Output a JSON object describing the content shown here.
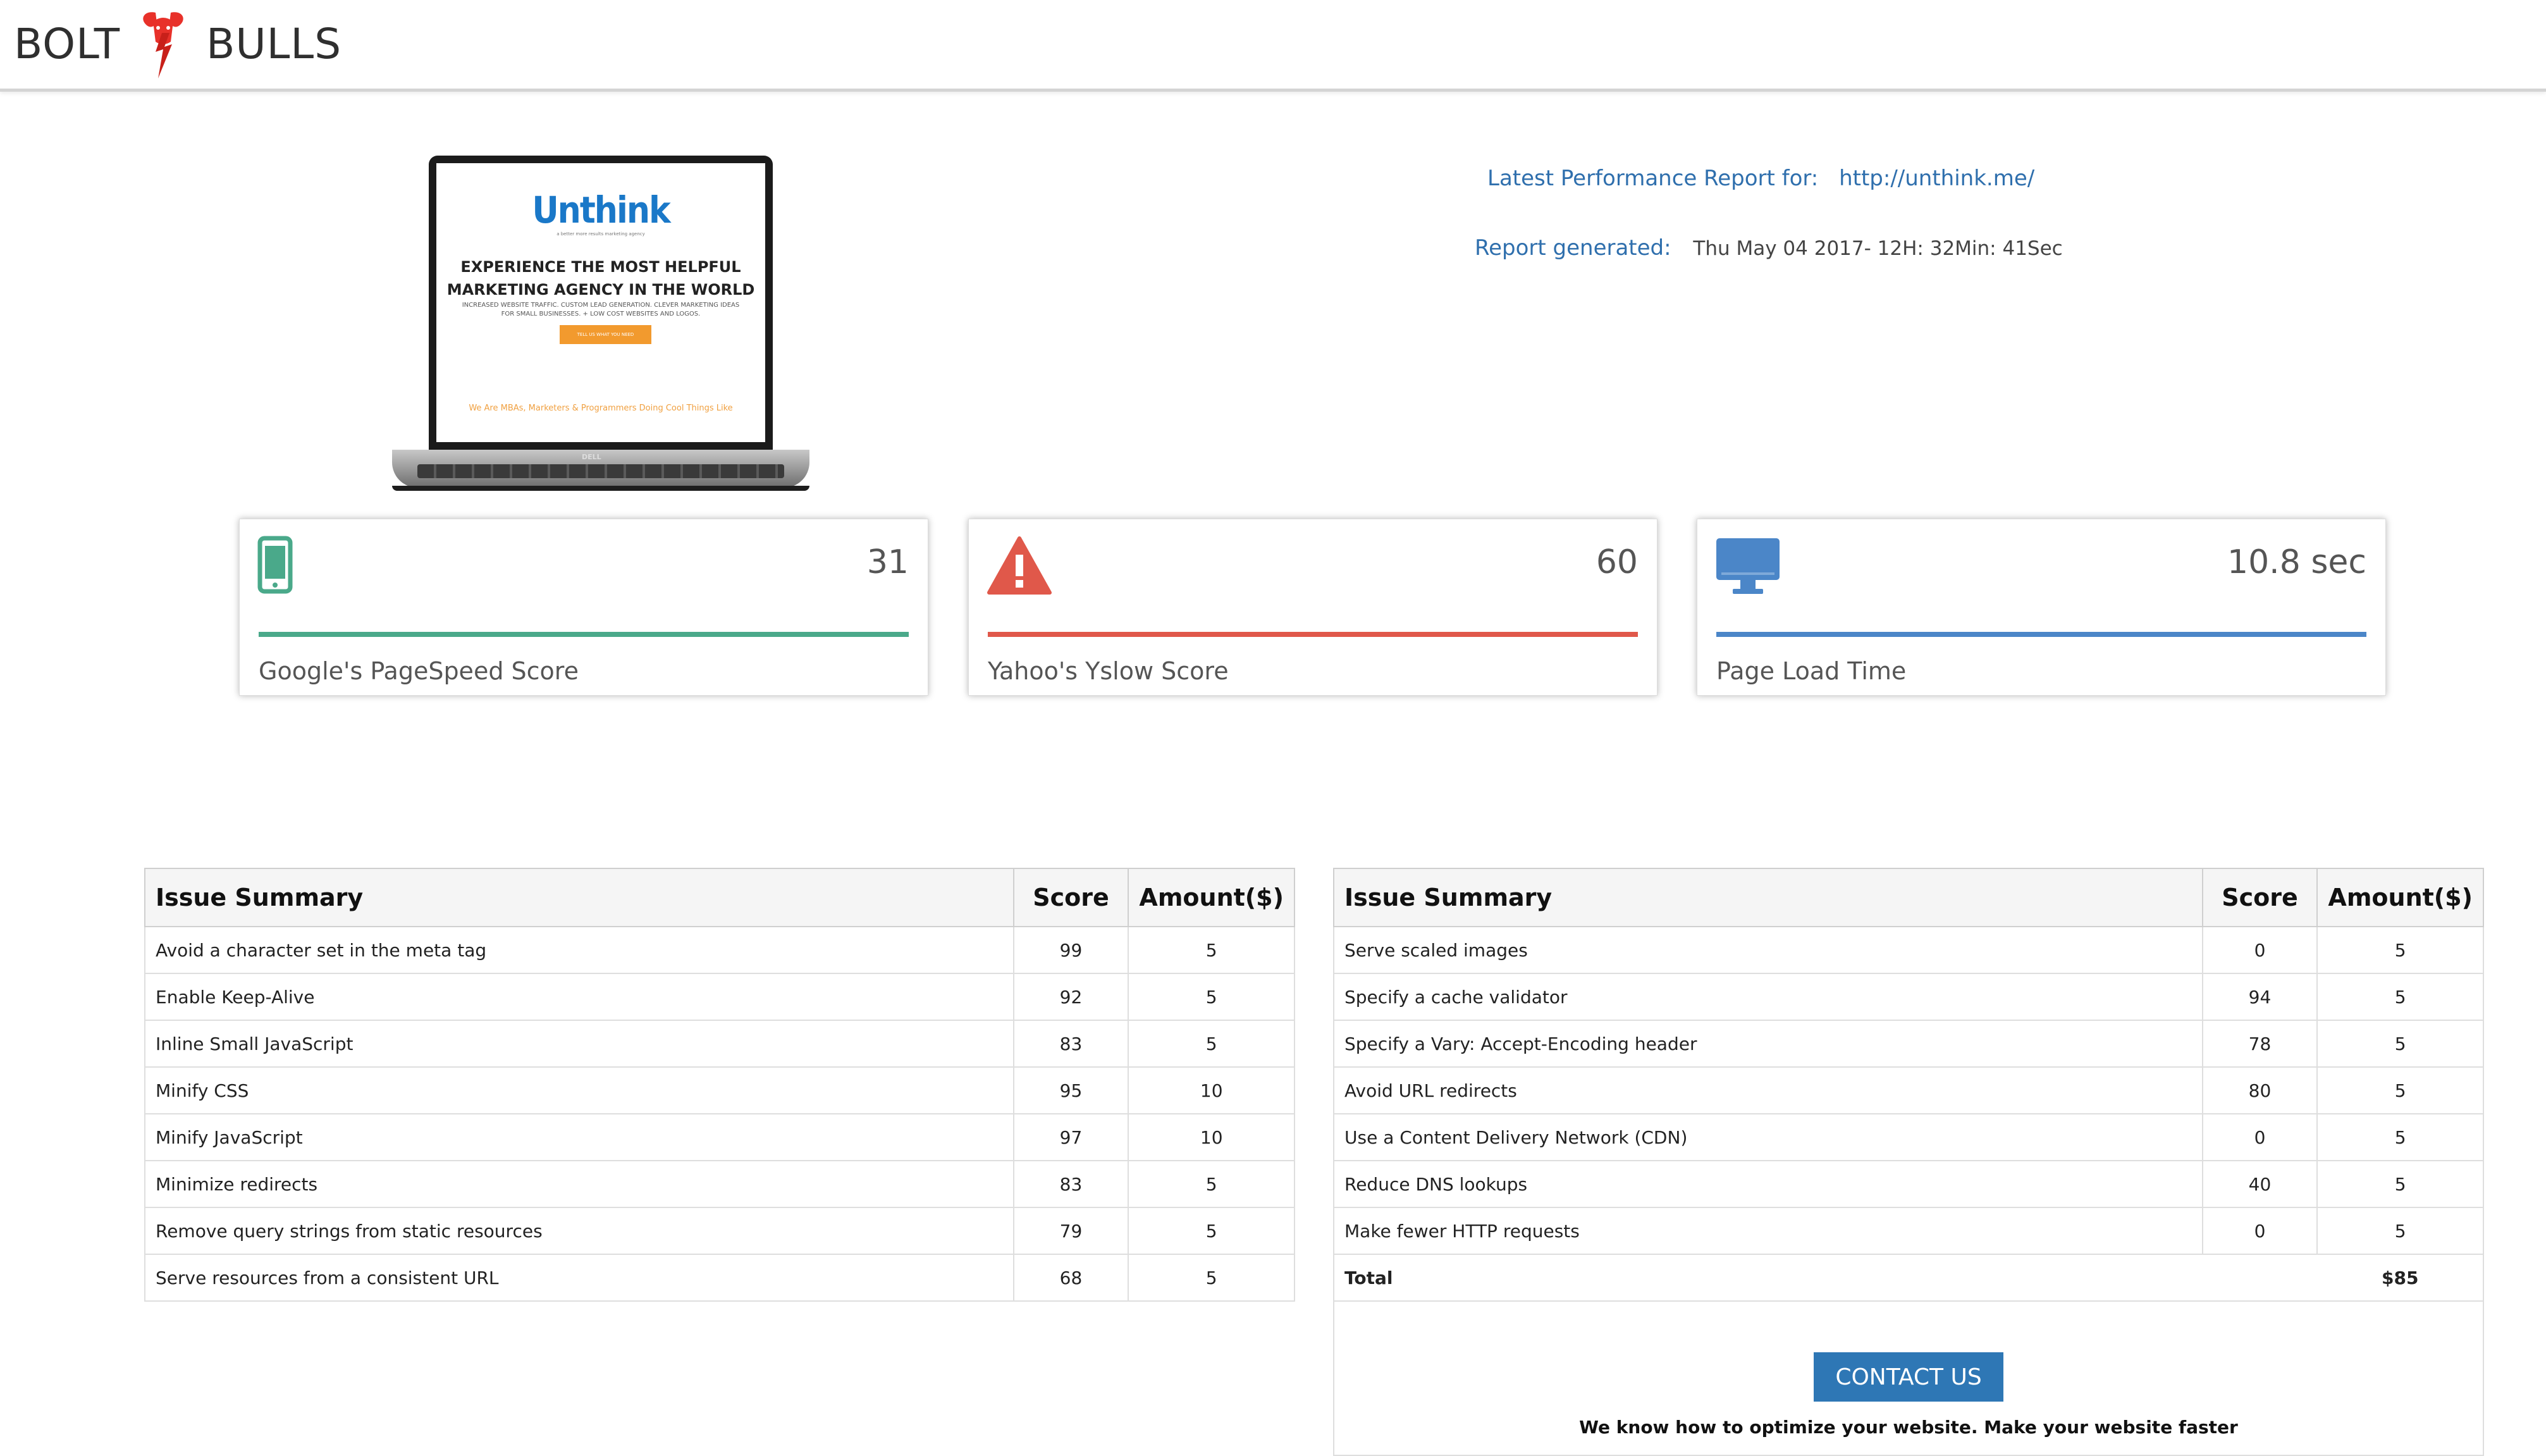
{
  "brand": {
    "left_word": "BOLT",
    "right_word": "BULLS"
  },
  "laptop_preview": {
    "site_name": "Unthink",
    "tagline": "a better more results marketing agency",
    "headline_line1": "EXPERIENCE THE MOST HELPFUL",
    "headline_line2": "MARKETING AGENCY IN THE WORLD",
    "subline1": "INCREASED WEBSITE TRAFFIC. CUSTOM LEAD GENERATION. CLEVER MARKETING IDEAS",
    "subline2": "FOR SMALL BUSINESSES. + LOW COST WEBSITES AND LOGOS.",
    "cta": "TELL US WHAT YOU NEED",
    "footer_text": "We Are MBAs, Marketers & Programmers Doing Cool Things Like",
    "device_brand": "DELL"
  },
  "report": {
    "for_label": "Latest Performance Report for:",
    "url": "http://unthink.me/",
    "generated_label": "Report generated:",
    "generated_value": "Thu May 04 2017- 12H: 32Min: 41Sec"
  },
  "cards": [
    {
      "value": "31",
      "label": "Google's PageSpeed Score",
      "icon": "mobile-phone-icon",
      "color": "#4aa98a"
    },
    {
      "value": "60",
      "label": "Yahoo's Yslow Score",
      "icon": "warning-icon",
      "color": "#e0584a"
    },
    {
      "value": "10.8 sec",
      "label": "Page Load Time",
      "icon": "desktop-monitor-icon",
      "color": "#4b86c8"
    }
  ],
  "table_headers": {
    "issue": "Issue Summary",
    "score": "Score",
    "amount": "Amount($)"
  },
  "left_table": [
    {
      "issue": "Avoid a character set in the meta tag",
      "score": "99",
      "amount": "5"
    },
    {
      "issue": "Enable Keep-Alive",
      "score": "92",
      "amount": "5"
    },
    {
      "issue": "Inline Small JavaScript",
      "score": "83",
      "amount": "5"
    },
    {
      "issue": "Minify CSS",
      "score": "95",
      "amount": "10"
    },
    {
      "issue": "Minify JavaScript",
      "score": "97",
      "amount": "10"
    },
    {
      "issue": "Minimize redirects",
      "score": "83",
      "amount": "5"
    },
    {
      "issue": "Remove query strings from static resources",
      "score": "79",
      "amount": "5"
    },
    {
      "issue": "Serve resources from a consistent URL",
      "score": "68",
      "amount": "5"
    }
  ],
  "right_table": [
    {
      "issue": "Serve scaled images",
      "score": "0",
      "amount": "5"
    },
    {
      "issue": "Specify a cache validator",
      "score": "94",
      "amount": "5"
    },
    {
      "issue": "Specify a Vary: Accept-Encoding header",
      "score": "78",
      "amount": "5"
    },
    {
      "issue": "Avoid URL redirects",
      "score": "80",
      "amount": "5"
    },
    {
      "issue": "Use a Content Delivery Network (CDN)",
      "score": "0",
      "amount": "5"
    },
    {
      "issue": "Reduce DNS lookups",
      "score": "40",
      "amount": "5"
    },
    {
      "issue": "Make fewer HTTP requests",
      "score": "0",
      "amount": "5"
    }
  ],
  "total": {
    "label": "Total",
    "value": "$85"
  },
  "contact": {
    "button_label": "CONTACT US",
    "note": "We know how to optimize your website. Make your website faster"
  }
}
